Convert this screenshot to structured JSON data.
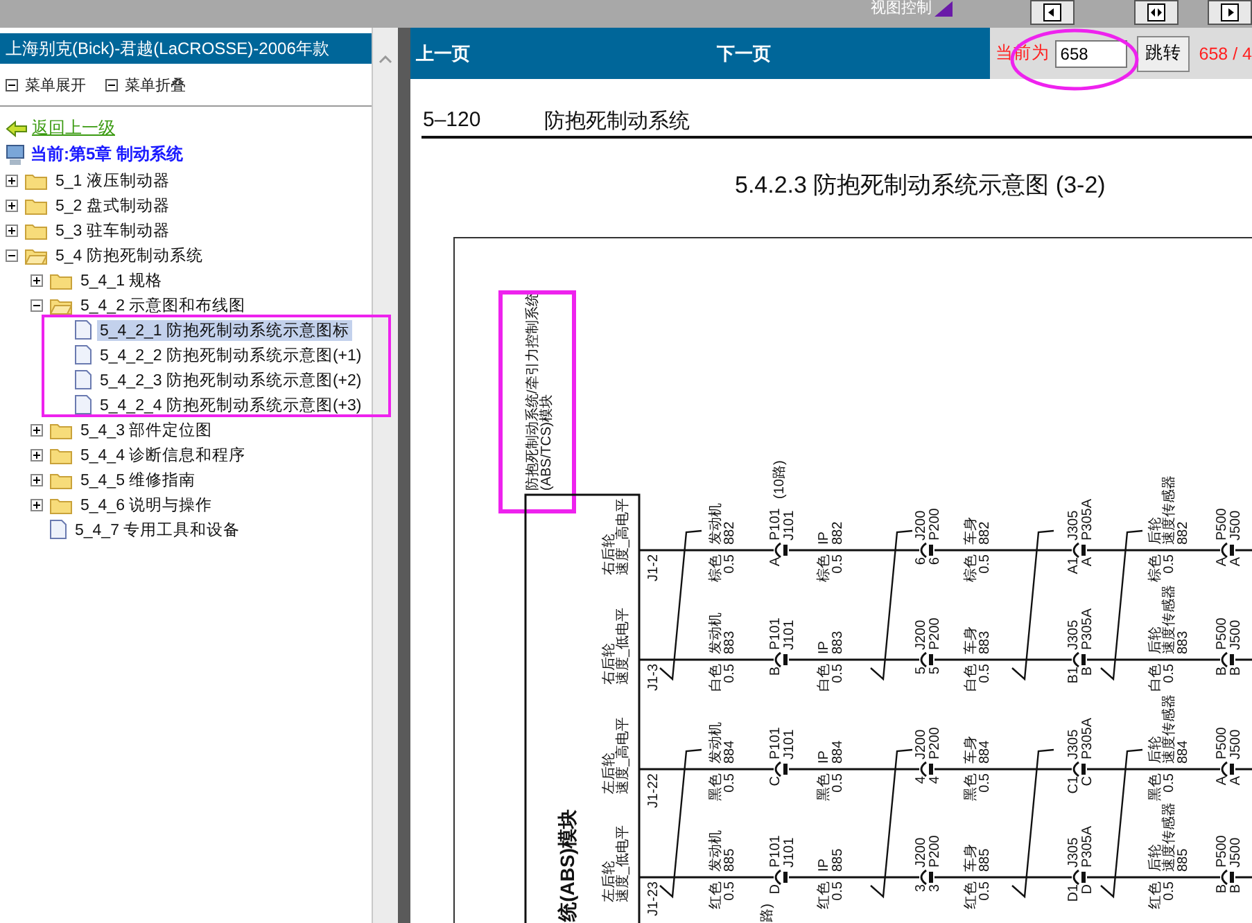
{
  "toolbar": {
    "label": "视图控制"
  },
  "sidebar": {
    "title": "上海别克(Bick)-君越(LaCROSSE)-2006年款",
    "menu_actions": [
      "菜单展开",
      "菜单折叠"
    ],
    "back_link": "返回上一级",
    "current": "当前:第5章 制动系统",
    "tree": [
      {
        "label": "5_1 液压制动器",
        "kind": "folder",
        "expanded": false,
        "selected": false
      },
      {
        "label": "5_2 盘式制动器",
        "kind": "folder",
        "expanded": false,
        "selected": false
      },
      {
        "label": "5_3 驻车制动器",
        "kind": "folder",
        "expanded": false,
        "selected": false
      },
      {
        "label": "5_4 防抱死制动系统",
        "kind": "folder",
        "expanded": true,
        "selected": false,
        "children": [
          {
            "label": "5_4_1 规格",
            "kind": "folder",
            "expanded": false,
            "selected": false
          },
          {
            "label": "5_4_2 示意图和布线图",
            "kind": "folder",
            "expanded": true,
            "selected": false,
            "children": [
              {
                "label": "5_4_2_1 防抱死制动系统示意图标",
                "kind": "page",
                "selected": true
              },
              {
                "label": "5_4_2_2 防抱死制动系统示意图(+1)",
                "kind": "page",
                "selected": false
              },
              {
                "label": "5_4_2_3 防抱死制动系统示意图(+2)",
                "kind": "page",
                "selected": false
              },
              {
                "label": "5_4_2_4 防抱死制动系统示意图(+3)",
                "kind": "page",
                "selected": false
              }
            ]
          },
          {
            "label": "5_4_3 部件定位图",
            "kind": "folder",
            "expanded": false,
            "selected": false
          },
          {
            "label": "5_4_4 诊断信息和程序",
            "kind": "folder",
            "expanded": false,
            "selected": false
          },
          {
            "label": "5_4_5 维修指南",
            "kind": "folder",
            "expanded": false,
            "selected": false
          },
          {
            "label": "5_4_6 说明与操作",
            "kind": "folder",
            "expanded": false,
            "selected": false
          },
          {
            "label": "5_4_7 专用工具和设备",
            "kind": "page",
            "selected": false
          }
        ]
      }
    ]
  },
  "nav": {
    "prev": "上一页",
    "next": "下一页",
    "page_label": "当前为",
    "page_value": "658",
    "jump": "跳转",
    "page_count": "658 / 4"
  },
  "document": {
    "page_number": "5–120",
    "section": "防抱死制动系统",
    "title": "5.4.2.3 防抱死制动系统示意图 (3-2)",
    "diagram": {
      "module_title": [
        "防抱死制动系统/牵引力控制系统",
        "(ABS/TCS)模块"
      ],
      "module_name": "统(ABS)模块",
      "fragment": "路)",
      "wires": [
        {
          "pin": "J1-2",
          "signal": [
            "右后轮",
            "速度_高电平"
          ],
          "stops": [
            {
              "kind": "label",
              "above": [
                "发动机",
                "882"
              ],
              "below": [
                "棕色",
                "0.5"
              ]
            },
            {
              "kind": "connector",
              "pins": [
                "A"
              ],
              "names": [
                "P101",
                "J101"
              ],
              "note": "(10路)"
            },
            {
              "kind": "label",
              "above": [
                "IP",
                "882"
              ],
              "below": [
                "棕色",
                "0.5"
              ]
            },
            {
              "kind": "connector",
              "pins": [
                "6",
                "6"
              ],
              "names": [
                "J200",
                "P200"
              ]
            },
            {
              "kind": "label",
              "above": [
                "车身",
                "882"
              ],
              "below": [
                "棕色",
                "0.5"
              ]
            },
            {
              "kind": "connector",
              "pins": [
                "A1",
                "A"
              ],
              "names": [
                "J305",
                "P305A"
              ]
            },
            {
              "kind": "label",
              "above": [
                "后轮",
                "速度传感器",
                "882"
              ],
              "below": [
                "棕色",
                "0.5"
              ]
            },
            {
              "kind": "connector",
              "pins": [
                "A",
                "A"
              ],
              "names": [
                "P500",
                "J500"
              ]
            }
          ]
        },
        {
          "pin": "J1-3",
          "signal": [
            "右后轮",
            "速度_低电平"
          ],
          "stops": [
            {
              "kind": "label",
              "above": [
                "发动机",
                "883"
              ],
              "below": [
                "白色",
                "0.5"
              ]
            },
            {
              "kind": "connector",
              "pins": [
                "B"
              ],
              "names": [
                "P101",
                "J101"
              ]
            },
            {
              "kind": "label",
              "above": [
                "IP",
                "883"
              ],
              "below": [
                "白色",
                "0.5"
              ]
            },
            {
              "kind": "connector",
              "pins": [
                "5",
                "5"
              ],
              "names": [
                "J200",
                "P200"
              ]
            },
            {
              "kind": "label",
              "above": [
                "车身",
                "883"
              ],
              "below": [
                "白色",
                "0.5"
              ]
            },
            {
              "kind": "connector",
              "pins": [
                "B1",
                "B"
              ],
              "names": [
                "J305",
                "P305A"
              ]
            },
            {
              "kind": "label",
              "above": [
                "后轮",
                "速度传感器",
                "883"
              ],
              "below": [
                "白色",
                "0.5"
              ]
            },
            {
              "kind": "connector",
              "pins": [
                "B",
                "B"
              ],
              "names": [
                "P500",
                "J500"
              ]
            }
          ]
        },
        {
          "pin": "J1-22",
          "signal": [
            "左后轮",
            "速度_高电平"
          ],
          "stops": [
            {
              "kind": "label",
              "above": [
                "发动机",
                "884"
              ],
              "below": [
                "黑色",
                "0.5"
              ]
            },
            {
              "kind": "connector",
              "pins": [
                "C"
              ],
              "names": [
                "P101",
                "J101"
              ]
            },
            {
              "kind": "label",
              "above": [
                "IP",
                "884"
              ],
              "below": [
                "黑色",
                "0.5"
              ]
            },
            {
              "kind": "connector",
              "pins": [
                "4",
                "4"
              ],
              "names": [
                "J200",
                "P200"
              ]
            },
            {
              "kind": "label",
              "above": [
                "车身",
                "884"
              ],
              "below": [
                "黑色",
                "0.5"
              ]
            },
            {
              "kind": "connector",
              "pins": [
                "C1",
                "C"
              ],
              "names": [
                "J305",
                "P305A"
              ]
            },
            {
              "kind": "label",
              "above": [
                "后轮",
                "速度传感器",
                "884"
              ],
              "below": [
                "黑色",
                "0.5"
              ]
            },
            {
              "kind": "connector",
              "pins": [
                "A",
                "A"
              ],
              "names": [
                "P500",
                "J500"
              ]
            }
          ]
        },
        {
          "pin": "J1-23",
          "signal": [
            "左后轮",
            "速度_低电平"
          ],
          "stops": [
            {
              "kind": "label",
              "above": [
                "发动机",
                "885"
              ],
              "below": [
                "红色",
                "0.5"
              ]
            },
            {
              "kind": "connector",
              "pins": [
                "D"
              ],
              "names": [
                "P101",
                "J101"
              ]
            },
            {
              "kind": "label",
              "above": [
                "IP",
                "885"
              ],
              "below": [
                "红色",
                "0.5"
              ]
            },
            {
              "kind": "connector",
              "pins": [
                "3",
                "3"
              ],
              "names": [
                "J200",
                "P200"
              ]
            },
            {
              "kind": "label",
              "above": [
                "车身",
                "885"
              ],
              "below": [
                "红色",
                "0.5"
              ]
            },
            {
              "kind": "connector",
              "pins": [
                "D1",
                "D"
              ],
              "names": [
                "J305",
                "P305A"
              ]
            },
            {
              "kind": "label",
              "above": [
                "后轮",
                "速度传感器",
                "885"
              ],
              "below": [
                "红色",
                "0.5"
              ]
            },
            {
              "kind": "connector",
              "pins": [
                "B",
                "B"
              ],
              "names": [
                "P500",
                "J500"
              ]
            }
          ]
        }
      ]
    }
  }
}
